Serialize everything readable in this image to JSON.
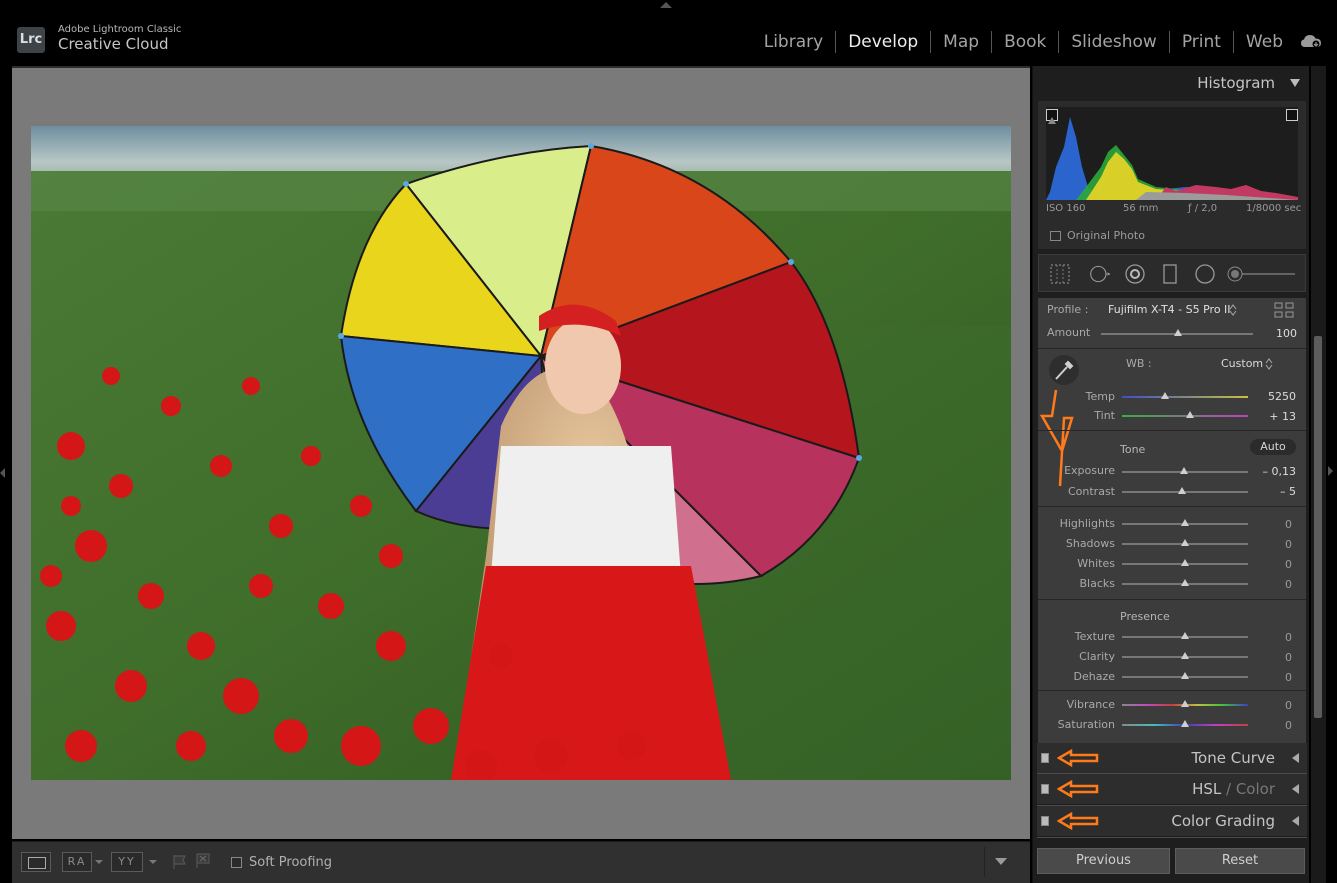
{
  "app": {
    "logo": "Lrc",
    "subtitle": "Adobe Lightroom Classic",
    "name": "Creative Cloud"
  },
  "modules": [
    {
      "label": "Library",
      "active": false
    },
    {
      "label": "Develop",
      "active": true
    },
    {
      "label": "Map",
      "active": false
    },
    {
      "label": "Book",
      "active": false
    },
    {
      "label": "Slideshow",
      "active": false
    },
    {
      "label": "Print",
      "active": false
    },
    {
      "label": "Web",
      "active": false
    }
  ],
  "toolbar": {
    "ra_label": "RA",
    "yy_label": "YY",
    "soft_proofing_label": "Soft Proofing"
  },
  "histogram": {
    "title": "Histogram",
    "iso": "ISO 160",
    "focal": "56 mm",
    "aperture": "ƒ / 2,0",
    "shutter": "1/8000 sec",
    "original_photo_label": "Original Photo"
  },
  "basic": {
    "profile_label": "Profile :",
    "profile_value": "Fujifilm X-T4 - S5 Pro II",
    "amount_label": "Amount",
    "amount_value": "100",
    "wb_label": "WB :",
    "wb_value": "Custom",
    "temp_label": "Temp",
    "temp_value": "5250",
    "tint_label": "Tint",
    "tint_value": "+ 13",
    "tone_label": "Tone",
    "auto_label": "Auto",
    "exposure_label": "Exposure",
    "exposure_value": "– 0,13",
    "contrast_label": "Contrast",
    "contrast_value": "– 5",
    "highlights_label": "Highlights",
    "highlights_value": "0",
    "shadows_label": "Shadows",
    "shadows_value": "0",
    "whites_label": "Whites",
    "whites_value": "0",
    "blacks_label": "Blacks",
    "blacks_value": "0",
    "presence_label": "Presence",
    "texture_label": "Texture",
    "texture_value": "0",
    "clarity_label": "Clarity",
    "clarity_value": "0",
    "dehaze_label": "Dehaze",
    "dehaze_value": "0",
    "vibrance_label": "Vibrance",
    "vibrance_value": "0",
    "saturation_label": "Saturation",
    "saturation_value": "0"
  },
  "panels": {
    "tone_curve": "Tone Curve",
    "hsl": "HSL",
    "hsl_sep": " / ",
    "color": "Color",
    "color_grading": "Color Grading"
  },
  "buttons": {
    "previous": "Previous",
    "reset": "Reset"
  },
  "colors": {
    "annotation_orange": "#ff7a1a",
    "panel_bg": "#3c3c3c",
    "active_module": "#ededed"
  }
}
